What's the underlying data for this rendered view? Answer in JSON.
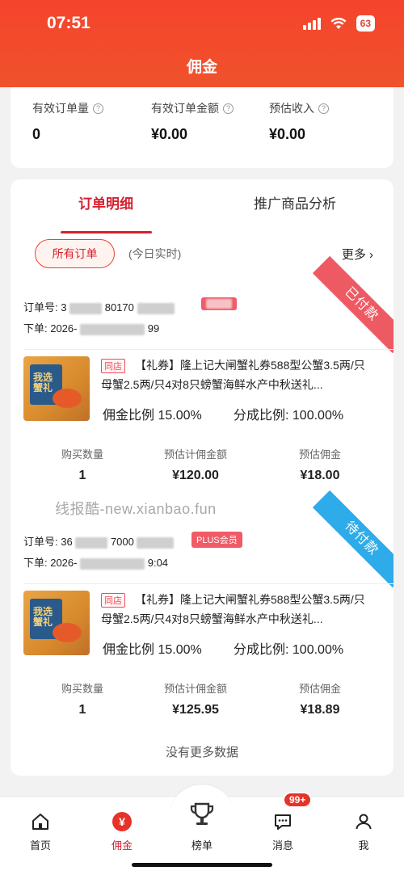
{
  "status_bar": {
    "time": "07:51",
    "battery": "63"
  },
  "header": {
    "title": "佣金"
  },
  "summary": [
    {
      "label": "有效订单量",
      "value": "0"
    },
    {
      "label": "有效订单金额",
      "value": "¥0.00"
    },
    {
      "label": "预估收入",
      "value": "¥0.00"
    }
  ],
  "tabs": [
    {
      "label": "订单明细"
    },
    {
      "label": "推广商品分析"
    }
  ],
  "filters": {
    "all": "所有订单",
    "today": "(今日实时)",
    "more": "更多 ›"
  },
  "orders": [
    {
      "order_no_label": "订单号: 3",
      "order_no_partial": "80170",
      "order_time_label": "下单: 2026-",
      "order_time_partial": "99",
      "status": "已付款",
      "badge": "",
      "shop_tag": "同店",
      "title": "【礼券】隆上记大闸蟹礼券588型公蟹3.5两/只母蟹2.5两/只4对8只螃蟹海鲜水产中秋送礼...",
      "commission_rate_label": "佣金比例",
      "commission_rate": "15.00%",
      "share_rate_label": "分成比例:",
      "share_rate": "100.00%",
      "qty_label": "购买数量",
      "qty": "1",
      "est_amount_label": "预估计佣金额",
      "est_amount": "¥120.00",
      "est_commission_label": "预估佣金",
      "est_commission": "¥18.00"
    },
    {
      "order_no_label": "订单号: 36",
      "order_no_partial": "7000",
      "order_time_label": "下单: 2026-",
      "order_time_partial": "9:04",
      "status": "待付款",
      "badge": "PLUS会员",
      "shop_tag": "同店",
      "title": "【礼券】隆上记大闸蟹礼券588型公蟹3.5两/只母蟹2.5两/只4对8只螃蟹海鲜水产中秋送礼...",
      "commission_rate_label": "佣金比例",
      "commission_rate": "15.00%",
      "share_rate_label": "分成比例:",
      "share_rate": "100.00%",
      "qty_label": "购买数量",
      "qty": "1",
      "est_amount_label": "预估计佣金额",
      "est_amount": "¥125.95",
      "est_commission_label": "预估佣金",
      "est_commission": "¥18.89"
    }
  ],
  "thumb_text": "我选蟹礼",
  "watermark": "线报酷-new.xianbao.fun",
  "no_more": "没有更多数据",
  "bottom_nav": [
    {
      "label": "首页",
      "icon": "home-icon"
    },
    {
      "label": "佣金",
      "icon": "yuan-icon"
    },
    {
      "label": "榜单",
      "icon": "trophy-icon"
    },
    {
      "label": "消息",
      "icon": "message-icon",
      "badge": "99+"
    },
    {
      "label": "我",
      "icon": "profile-icon"
    }
  ],
  "colors": {
    "brand_red": "#f0522c",
    "accent": "#d6202f",
    "paid_ribbon": "#ee5a63",
    "pending_ribbon": "#2eabe9"
  }
}
